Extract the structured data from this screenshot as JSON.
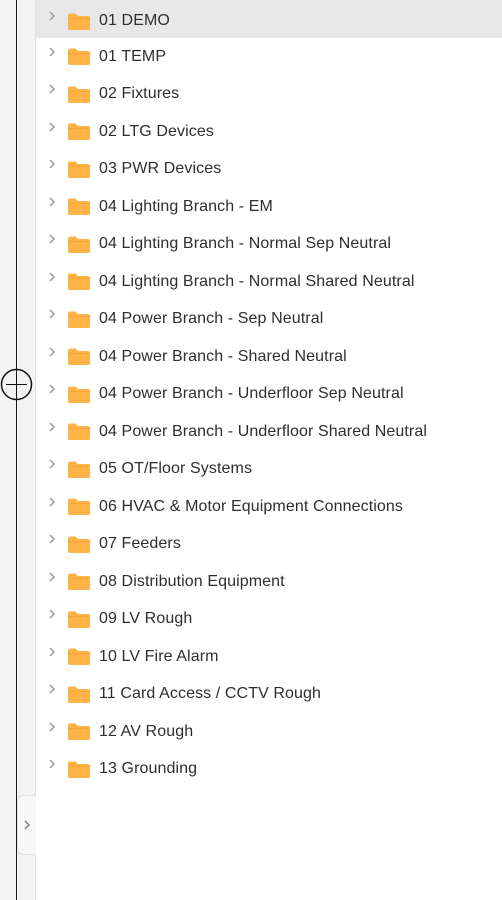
{
  "colors": {
    "folder": "#FFB347",
    "selected_row": "#E8E8E8"
  },
  "icons": {
    "row_expand": "chevron-right-icon",
    "row_type": "folder-icon",
    "panel_toggle": "chevron-right-icon"
  },
  "tree": {
    "items": [
      {
        "label": "01 DEMO",
        "selected": true
      },
      {
        "label": "01 TEMP"
      },
      {
        "label": "02 Fixtures"
      },
      {
        "label": "02 LTG Devices"
      },
      {
        "label": "03 PWR Devices"
      },
      {
        "label": "04 Lighting Branch - EM"
      },
      {
        "label": "04 Lighting Branch - Normal Sep Neutral"
      },
      {
        "label": "04 Lighting Branch - Normal Shared Neutral"
      },
      {
        "label": "04 Power Branch - Sep Neutral"
      },
      {
        "label": "04 Power Branch - Shared Neutral"
      },
      {
        "label": "04 Power Branch - Underfloor Sep Neutral"
      },
      {
        "label": "04 Power Branch - Underfloor Shared Neutral"
      },
      {
        "label": "05 OT/Floor Systems"
      },
      {
        "label": "06 HVAC & Motor Equipment Connections"
      },
      {
        "label": "07 Feeders"
      },
      {
        "label": "08 Distribution Equipment"
      },
      {
        "label": "09 LV Rough"
      },
      {
        "label": "10 LV Fire Alarm"
      },
      {
        "label": "11 Card Access / CCTV Rough"
      },
      {
        "label": "12 AV Rough"
      },
      {
        "label": "13 Grounding"
      }
    ]
  }
}
